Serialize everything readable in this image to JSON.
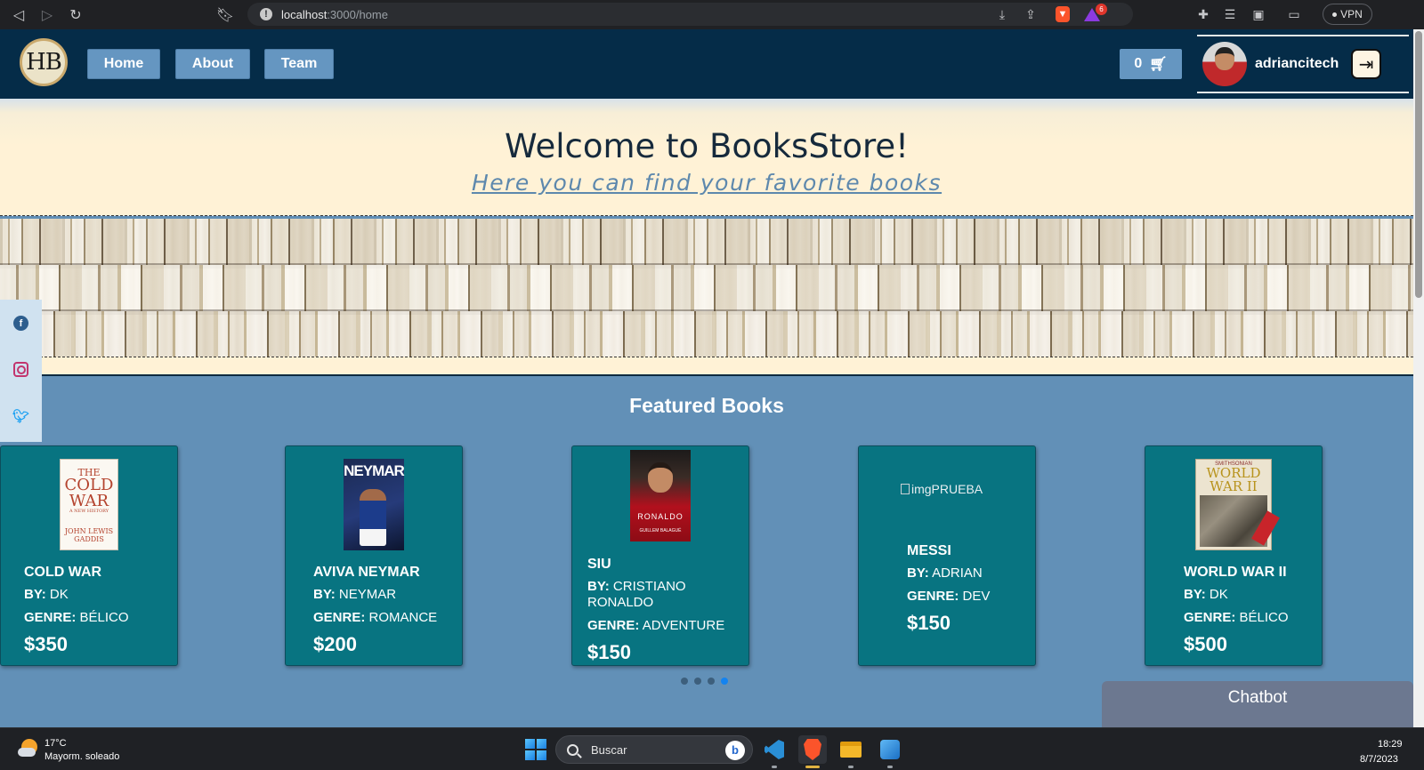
{
  "browser": {
    "url_host": "localhost",
    "url_path": ":3000/home",
    "rewards_badge": "6",
    "vpn_label": "VPN"
  },
  "navbar": {
    "logo_text": "HB",
    "links": [
      "Home",
      "About",
      "Team"
    ],
    "cart_count": "0",
    "user_name": "adriancitech"
  },
  "hero": {
    "title": "Welcome to BooksStore!",
    "subtitle": "Here you can find your favorite books"
  },
  "featured": {
    "title": "Featured Books",
    "author_label": "BY:",
    "genre_label": "GENRE:",
    "cards": [
      {
        "title": "COLD WAR",
        "author": "DK",
        "genre": "BÉLICO",
        "price": "$350",
        "cover_lines": [
          "THE",
          "COLD WAR",
          "A NEW HISTORY",
          "JOHN LEWIS GADDIS"
        ]
      },
      {
        "title": "AVIVA NEYMAR",
        "author": "NEYMAR",
        "genre": "ROMANCE",
        "price": "$200",
        "cover_lines": [
          "NEYMAR"
        ]
      },
      {
        "title": "SIU",
        "author": "CRISTIANO RONALDO",
        "genre": "ADVENTURE",
        "price": "$150",
        "cover_lines": [
          "RONALDO",
          "GUILLEM BALAGUÉ"
        ]
      },
      {
        "title": "MESSI",
        "author": "ADRIAN",
        "genre": "DEV",
        "price": "$150",
        "cover_alt": "imgPRUEBA"
      },
      {
        "title": "WORLD WAR II",
        "author": "DK",
        "genre": "BÉLICO",
        "price": "$500",
        "cover_lines": [
          "SMITHSONIAN",
          "WORLD WAR II"
        ]
      }
    ],
    "carousel_pages": 4,
    "carousel_active": 4
  },
  "chatbot": {
    "label": "Chatbot"
  },
  "taskbar": {
    "weather_temp": "17°C",
    "weather_desc": "Mayorm. soleado",
    "search_placeholder": "Buscar",
    "time": "18:29",
    "date": "8/7/2023"
  },
  "colors": {
    "navbar_bg": "#052c48",
    "nav_button": "#6596c1",
    "page_bg": "#6290b7",
    "card_bg": "#087481",
    "hero_bg": "#fff2d6",
    "dot_active": "#1383f0"
  }
}
